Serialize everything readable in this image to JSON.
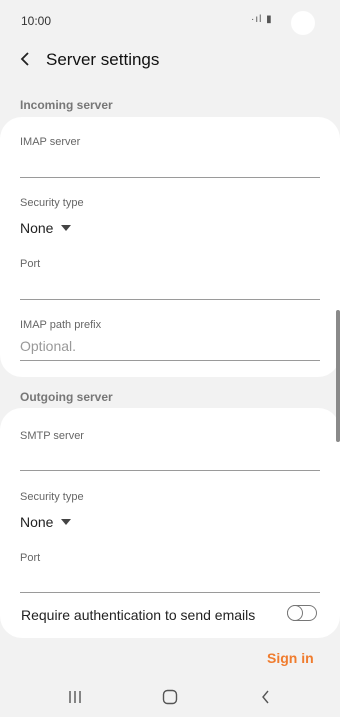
{
  "status_bar": {
    "time": "10:00",
    "signal_icons": "·ıl ▮"
  },
  "header": {
    "title": "Server settings"
  },
  "incoming": {
    "header": "Incoming server",
    "server_label": "IMAP server",
    "server_value": "",
    "security_label": "Security type",
    "security_value": "None",
    "port_label": "Port",
    "port_value": "",
    "path_prefix_label": "IMAP path prefix",
    "path_prefix_placeholder": "Optional."
  },
  "outgoing": {
    "header": "Outgoing server",
    "server_label": "SMTP server",
    "server_value": "",
    "security_label": "Security type",
    "security_value": "None",
    "port_label": "Port",
    "port_value": "",
    "auth_label": "Require authentication to send emails",
    "auth_enabled": false
  },
  "actions": {
    "sign_in": "Sign in"
  },
  "colors": {
    "accent": "#f07c2e",
    "background": "#f2f2f2",
    "card": "#ffffff"
  },
  "icons": {
    "back": "chevron-left-icon",
    "caret": "caret-down-icon",
    "nav_recents": "recents-icon",
    "nav_home": "home-icon",
    "nav_back": "nav-back-icon"
  }
}
